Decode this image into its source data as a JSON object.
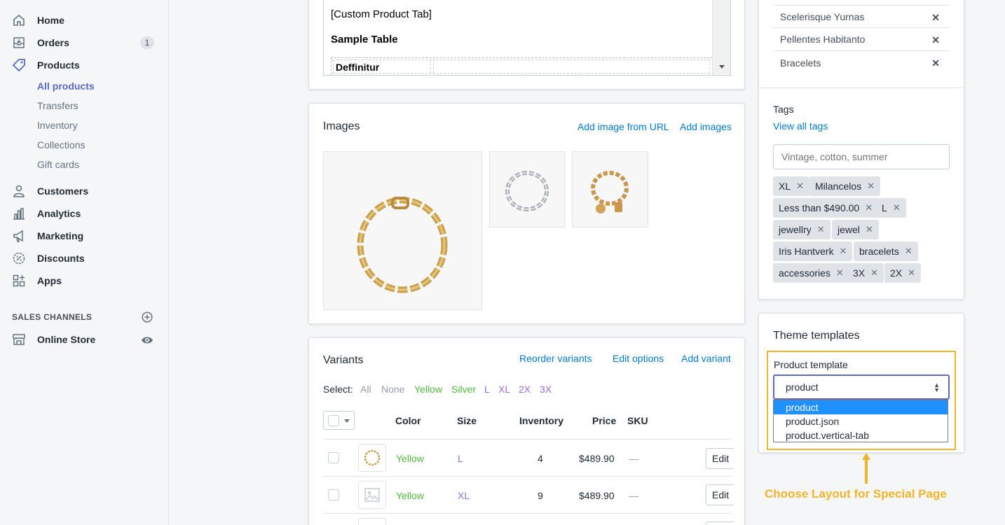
{
  "sidebar": {
    "nav": [
      {
        "label": "Home",
        "icon": "home-icon"
      },
      {
        "label": "Orders",
        "icon": "orders-icon",
        "badge": "1"
      },
      {
        "label": "Products",
        "icon": "tag-icon"
      }
    ],
    "products_sub": [
      "All products",
      "Transfers",
      "Inventory",
      "Collections",
      "Gift cards"
    ],
    "nav2": [
      {
        "label": "Customers",
        "icon": "person-icon"
      },
      {
        "label": "Analytics",
        "icon": "bar-chart-icon"
      },
      {
        "label": "Marketing",
        "icon": "megaphone-icon"
      },
      {
        "label": "Discounts",
        "icon": "discount-icon"
      },
      {
        "label": "Apps",
        "icon": "apps-icon"
      }
    ],
    "sales_channels_heading": "SALES CHANNELS",
    "online_store": "Online Store"
  },
  "editor": {
    "line1": "[Custom Product Tab]",
    "line2": "Sample Table",
    "line3": "Deffinitur"
  },
  "images": {
    "title": "Images",
    "add_url": "Add image from URL",
    "add_images": "Add images"
  },
  "variants": {
    "title": "Variants",
    "reorder": "Reorder variants",
    "edit_options": "Edit options",
    "add_variant": "Add variant",
    "select_label": "Select:",
    "select_opts": [
      "All",
      "None",
      "Yellow",
      "Silver",
      "L",
      "XL",
      "2X",
      "3X"
    ],
    "headers": [
      "Color",
      "Size",
      "Inventory",
      "Price",
      "SKU"
    ],
    "rows": [
      {
        "color": "Yellow",
        "size": "L",
        "inventory": "4",
        "price": "$489.90",
        "sku": "—",
        "edit": "Edit"
      },
      {
        "color": "Yellow",
        "size": "XL",
        "inventory": "9",
        "price": "$489.90",
        "sku": "—",
        "edit": "Edit"
      }
    ]
  },
  "collections": [
    "Scelerisque Yurnas",
    "Pellentes Habitanto",
    "Bracelets"
  ],
  "tags": {
    "title": "Tags",
    "view_all": "View all tags",
    "placeholder": "Vintage, cotton, summer",
    "items": [
      "XL",
      "Milancelos",
      "Less than $490.00",
      "L",
      "jewellry",
      "jewel",
      "Iris Hantverk",
      "bracelets",
      "accessories",
      "3X",
      "2X"
    ]
  },
  "theme": {
    "title": "Theme templates",
    "label": "Product template",
    "selected": "product",
    "options": [
      "product",
      "product.json",
      "product.vertical-tab"
    ]
  },
  "callout": "Choose Layout for Special Page",
  "colors": {
    "accent": "#5c6ac4",
    "link": "#007ace",
    "green": "#50b83c",
    "purple": "#9c6ade",
    "highlight": "#f0b429"
  }
}
